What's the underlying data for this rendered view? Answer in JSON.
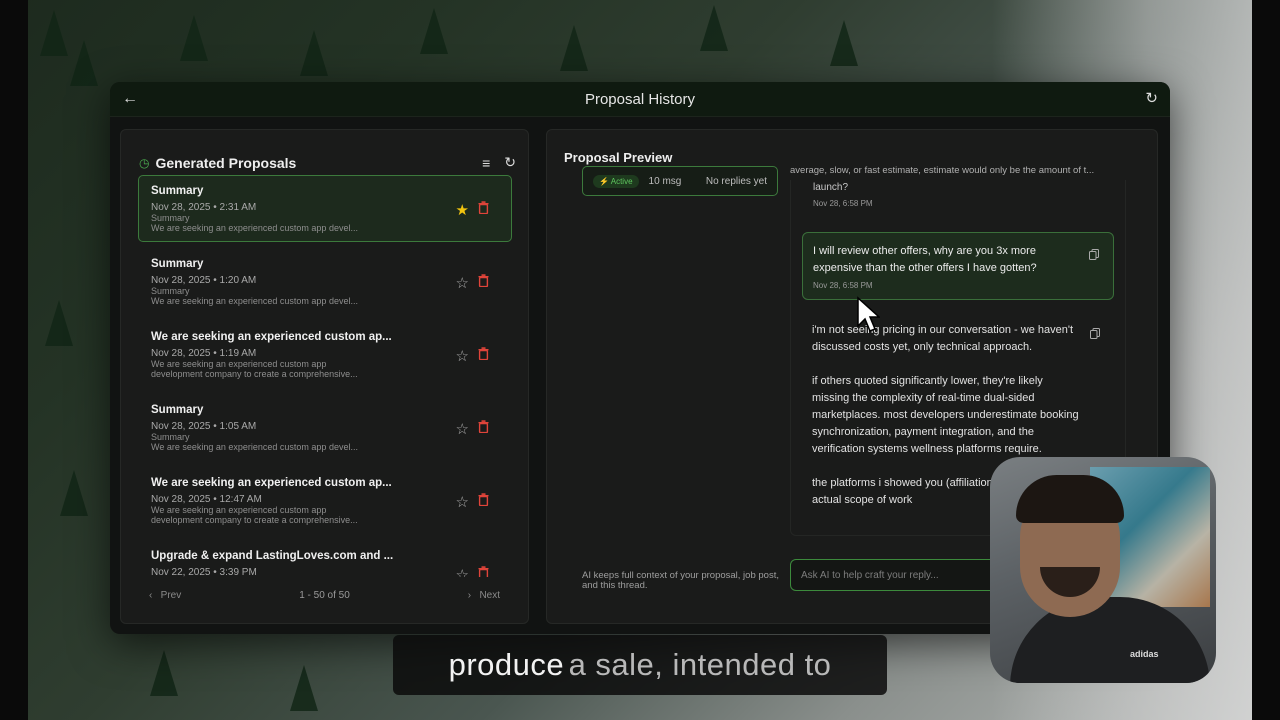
{
  "window": {
    "title": "Proposal History"
  },
  "left_panel": {
    "title": "Generated Proposals",
    "proposals": [
      {
        "title": "Summary",
        "date": "Nov 28, 2025 • 2:31 AM",
        "line1": "Summary",
        "line2": "We are seeking an experienced custom app devel...",
        "starred": true,
        "active": true
      },
      {
        "title": "Summary",
        "date": "Nov 28, 2025 • 1:20 AM",
        "line1": "Summary",
        "line2": "We are seeking an experienced custom app devel...",
        "starred": false,
        "active": false
      },
      {
        "title": "We are seeking an experienced custom ap...",
        "date": "Nov 28, 2025 • 1:19 AM",
        "line1": "We are seeking an experienced custom app",
        "line2": "development company to create a comprehensive...",
        "starred": false,
        "active": false
      },
      {
        "title": "Summary",
        "date": "Nov 28, 2025 • 1:05 AM",
        "line1": "Summary",
        "line2": "We are seeking an experienced custom app devel...",
        "starred": false,
        "active": false
      },
      {
        "title": "We are seeking an experienced custom ap...",
        "date": "Nov 28, 2025 • 12:47 AM",
        "line1": "We are seeking an experienced custom app",
        "line2": "development company to create a comprehensive...",
        "starred": false,
        "active": false
      },
      {
        "title": "Upgrade & expand LastingLoves.com and ...",
        "date": "Nov 22, 2025 • 3:39 PM",
        "line1": "",
        "line2": "",
        "starred": false,
        "active": false
      }
    ],
    "pager": {
      "prev": "Prev",
      "count": "1 - 50 of 50",
      "next": "Next"
    }
  },
  "right_panel": {
    "title": "Proposal Preview",
    "thread": {
      "status": "Active",
      "messages": "10 msg",
      "replies": "No replies yet"
    },
    "top_truncated": "average, slow, or fast estimate, estimate would only be the amount of t...",
    "partial_msg": {
      "text": "launch?",
      "time": "Nov 28, 6:58 PM"
    },
    "user_msg": {
      "text": "I will review other offers, why are you 3x more expensive than the other offers I have gotten?",
      "time": "Nov 28, 6:58 PM"
    },
    "ai_msg": {
      "text": "i'm not seeing pricing in our conversation - we haven't discussed costs yet, only technical approach.\n\nif others quoted significantly lower, they're likely missing the complexity of real-time dual-sided marketplaces. most developers underestimate booking synchronization, payment integration, and the verification systems wellness platforms require.\n\nthe platforms i showed you (affiliation) represent the actual scope of work"
    },
    "composer": {
      "note": "AI keeps full context of your proposal, job post, and this thread.",
      "placeholder": "Ask AI to help craft your reply..."
    }
  },
  "webcam": {
    "logo_text": "adidas"
  },
  "caption": {
    "bright": "produce",
    "dim": "a sale, intended to"
  },
  "colors": {
    "accent": "#4caf50",
    "star": "#f1c40f",
    "trash": "#e0443a"
  }
}
